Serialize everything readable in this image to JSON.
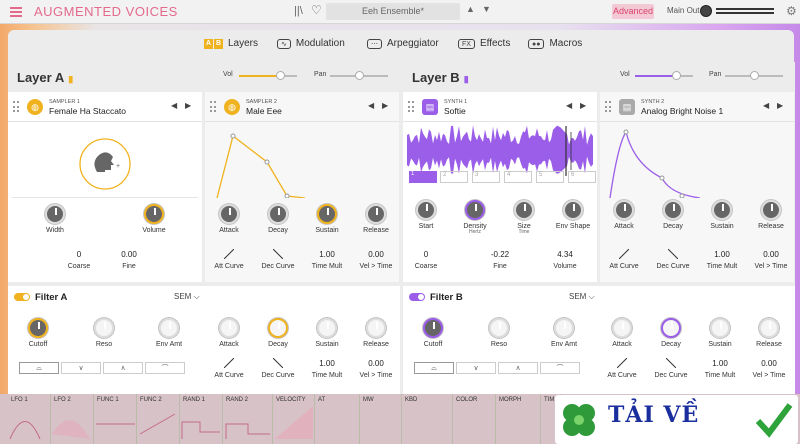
{
  "header": {
    "brand": "AUGMENTED VOICES",
    "preset_name": "Eeh Ensemble*",
    "advanced": "Advanced",
    "main_out": "Main Out"
  },
  "tabs": [
    {
      "label": "Layers",
      "icon": "A B"
    },
    {
      "label": "Modulation",
      "icon": "~"
    },
    {
      "label": "Arpeggiator",
      "icon": "arp"
    },
    {
      "label": "Effects",
      "icon": "FX"
    },
    {
      "label": "Macros",
      "icon": "macros"
    }
  ],
  "layer_a": {
    "title": "Layer A",
    "vol_label": "Vol",
    "pan_label": "Pan",
    "vol_level": 0.6,
    "pan_level": 0.5,
    "accent": "#f0b21f",
    "source1": {
      "type": "SAMPLER 1",
      "name": "Female Ha Staccato",
      "knobs": [
        "Width",
        "Volume"
      ],
      "values": [
        {
          "v": "0",
          "l": "Coarse"
        },
        {
          "v": "0.00",
          "l": "Fine"
        }
      ]
    },
    "source2": {
      "type": "SAMPLER 2",
      "name": "Male Eee",
      "knobs": [
        "Attack",
        "Decay",
        "Sustain",
        "Release"
      ],
      "values": [
        {
          "v": "",
          "l": "Att Curve"
        },
        {
          "v": "",
          "l": "Dec Curve"
        },
        {
          "v": "1.00",
          "l": "Time Mult"
        },
        {
          "v": "0.00",
          "l": "Vel > Time"
        }
      ]
    },
    "filter": {
      "title": "Filter A",
      "type": "SEM",
      "knobs": [
        "Cutoff",
        "Reso",
        "Env Amt"
      ],
      "env_knobs": [
        "Attack",
        "Decay",
        "Sustain",
        "Release"
      ],
      "env_values": [
        {
          "v": "",
          "l": "Att Curve"
        },
        {
          "v": "",
          "l": "Dec Curve"
        },
        {
          "v": "1.00",
          "l": "Time Mult"
        },
        {
          "v": "0.00",
          "l": "Vel > Time"
        }
      ]
    }
  },
  "layer_b": {
    "title": "Layer B",
    "vol_label": "Vol",
    "pan_label": "Pan",
    "vol_level": 0.6,
    "pan_level": 0.5,
    "accent": "#9a5ee8",
    "source1": {
      "type": "SYNTH 1",
      "name": "Softie",
      "knobs": [
        "Start",
        "Density",
        "Size",
        "Env Shape"
      ],
      "subs": [
        "Hertz",
        "Time"
      ],
      "values": [
        {
          "v": "0",
          "l": "Coarse"
        },
        {
          "v": "-0.22",
          "l": "Fine"
        },
        {
          "v": "4.34",
          "l": "Volume"
        }
      ]
    },
    "source2": {
      "type": "SYNTH 2",
      "name": "Analog Bright Noise 1",
      "knobs": [
        "Attack",
        "Decay",
        "Sustain",
        "Release"
      ],
      "values": [
        {
          "v": "",
          "l": "Att Curve"
        },
        {
          "v": "",
          "l": "Dec Curve"
        },
        {
          "v": "1.00",
          "l": "Time Mult"
        },
        {
          "v": "0.00",
          "l": "Vel > Time"
        }
      ]
    },
    "grain_slots": [
      "1",
      "2",
      "3",
      "4",
      "5",
      "6"
    ],
    "filter": {
      "title": "Filter B",
      "type": "SEM",
      "knobs": [
        "Cutoff",
        "Reso",
        "Env Amt"
      ],
      "env_knobs": [
        "Attack",
        "Decay",
        "Sustain",
        "Release"
      ],
      "env_values": [
        {
          "v": "",
          "l": "Att Curve"
        },
        {
          "v": "",
          "l": "Dec Curve"
        },
        {
          "v": "1.00",
          "l": "Time Mult"
        },
        {
          "v": "0.00",
          "l": "Vel > Time"
        }
      ]
    }
  },
  "mod_strip": [
    "LFO 1",
    "LFO 2",
    "FUNC 1",
    "FUNC 2",
    "RAND 1",
    "RAND 2",
    "VELOCITY",
    "AT",
    "MW",
    "KBD",
    "COLOR",
    "MORPH",
    "TIM"
  ],
  "watermark": {
    "text": "TẢI VỀ"
  }
}
